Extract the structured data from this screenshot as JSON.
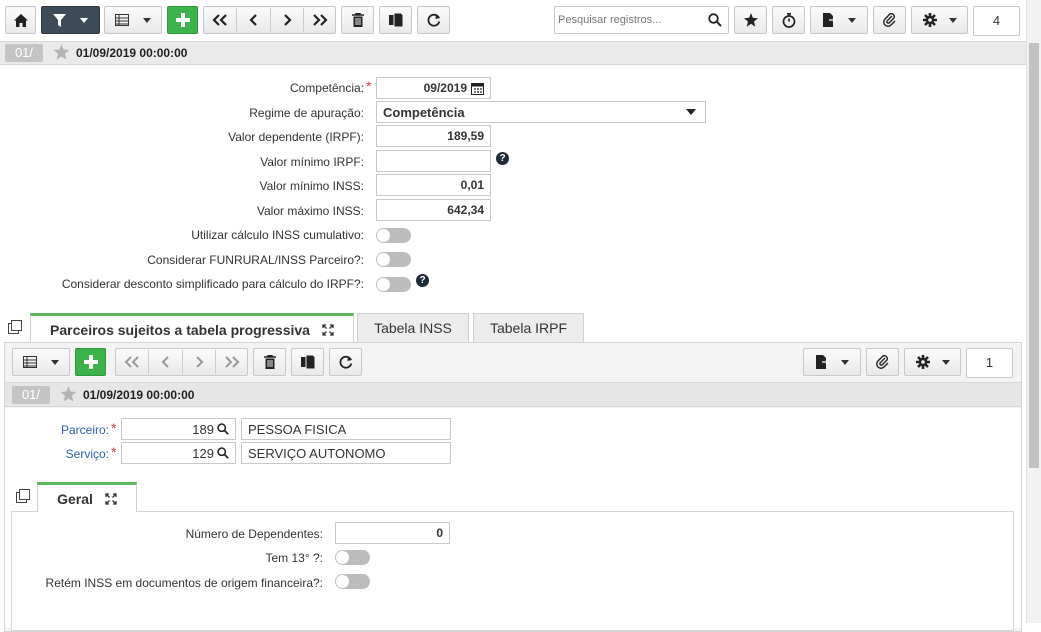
{
  "toolbar": {
    "search_placeholder": "Pesquisar registros...",
    "page_number": "4"
  },
  "record": {
    "badge": "01/",
    "date": "01/09/2019 00:00:00"
  },
  "form": {
    "competencia_label": "Competência:",
    "competencia_value": "09/2019",
    "regime_label": "Regime de apuração:",
    "regime_value": "Competência",
    "valor_dependente_label": "Valor dependente (IRPF):",
    "valor_dependente_value": "189,59",
    "valor_minimo_irpf_label": "Valor mínimo IRPF:",
    "valor_minimo_irpf_value": "",
    "valor_minimo_inss_label": "Valor mínimo INSS:",
    "valor_minimo_inss_value": "0,01",
    "valor_maximo_inss_label": "Valor máximo INSS:",
    "valor_maximo_inss_value": "642,34",
    "inss_cumulativo_label": "Utilizar cálculo INSS cumulativo:",
    "funrural_label": "Considerar FUNRURAL/INSS Parceiro?:",
    "desconto_simplificado_label": "Considerar desconto simplificado para cálculo do IRPF?:"
  },
  "tabs": [
    {
      "label": "Parceiros sujeitos a tabela progressiva"
    },
    {
      "label": "Tabela INSS"
    },
    {
      "label": "Tabela IRPF"
    }
  ],
  "detail": {
    "page_number": "1",
    "badge": "01/",
    "date": "01/09/2019 00:00:00",
    "parceiro_label": "Parceiro:",
    "parceiro_code": "189",
    "parceiro_name": "PESSOA FISICA",
    "servico_label": "Serviço:",
    "servico_code": "129",
    "servico_name": "SERVIÇO AUTONOMO"
  },
  "geral": {
    "tab_label": "Geral",
    "dependentes_label": "Número de Dependentes:",
    "dependentes_value": "0",
    "tem13_label": "Tem 13° ?:",
    "retem_inss_label": "Retém INSS em documentos de origem financeira?:"
  }
}
